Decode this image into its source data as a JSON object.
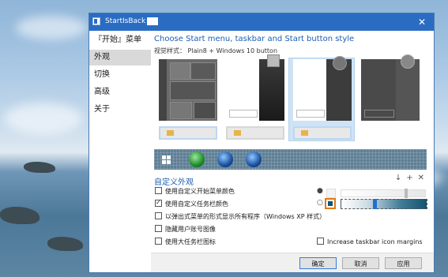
{
  "window": {
    "title": "StartIsBack ",
    "close_glyph": "✕"
  },
  "sidebar": {
    "items": [
      {
        "label": "『开始』菜单"
      },
      {
        "label": "外观"
      },
      {
        "label": "切换"
      },
      {
        "label": "高级"
      },
      {
        "label": "关于"
      }
    ]
  },
  "main": {
    "heading": "Choose Start menu, taskbar and Start button style",
    "visual_style_label": "视觉样式：  Plain8 + Windows 10 button",
    "custom_title": "自定义外观",
    "toolbar_icons": {
      "down": "↓",
      "add": "+",
      "close": "✕"
    },
    "options": [
      {
        "label": "使用自定义开始菜单颜色",
        "checked": false
      },
      {
        "label": "使用自定义任务栏颜色",
        "checked": true
      },
      {
        "label": "以弹出式菜单的形式显示所有程序（Windows XP 样式）",
        "checked": false
      },
      {
        "label": "隐藏用户账号图像",
        "checked": false
      },
      {
        "label": "使用大任务栏图标",
        "checked": false
      },
      {
        "label": "Increase taskbar icon margins",
        "checked": false
      }
    ]
  },
  "colors": {
    "accent": "#2b6cc3",
    "taskbar_color": "#14546e",
    "selected_thumb": "#cfe3f6"
  },
  "buttons": {
    "ok": "确定",
    "cancel": "取消",
    "apply": "应用"
  }
}
